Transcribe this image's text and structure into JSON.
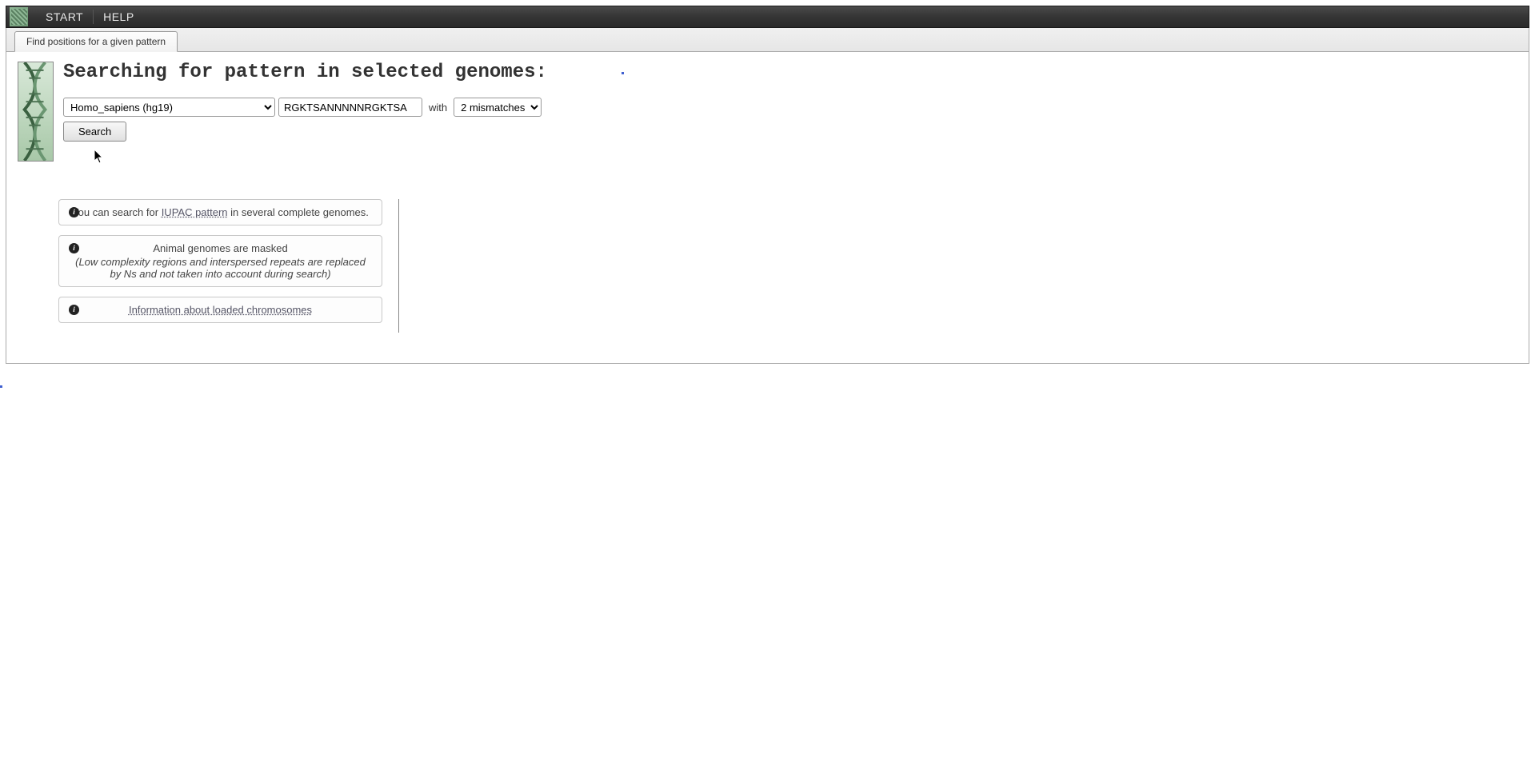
{
  "menubar": {
    "items": [
      "START",
      "HELP"
    ]
  },
  "tab": {
    "label": "Find positions for a given pattern"
  },
  "page": {
    "heading": "Searching for pattern in selected genomes:"
  },
  "form": {
    "genome_selected": "Homo_sapiens (hg19)",
    "pattern_value": "RGKTSANNNNNRGKTSA",
    "with_label": "with",
    "mismatch_selected": "2 mismatches",
    "search_label": "Search"
  },
  "info": {
    "box1_pre": "You can search for ",
    "box1_link": "IUPAC pattern",
    "box1_post": " in several complete genomes.",
    "box2_title": "Animal genomes are masked",
    "box2_note": "(Low complexity regions and interspersed repeats are replaced by Ns and not taken into account during search)",
    "box3_link": "Information about loaded chromosomes"
  }
}
